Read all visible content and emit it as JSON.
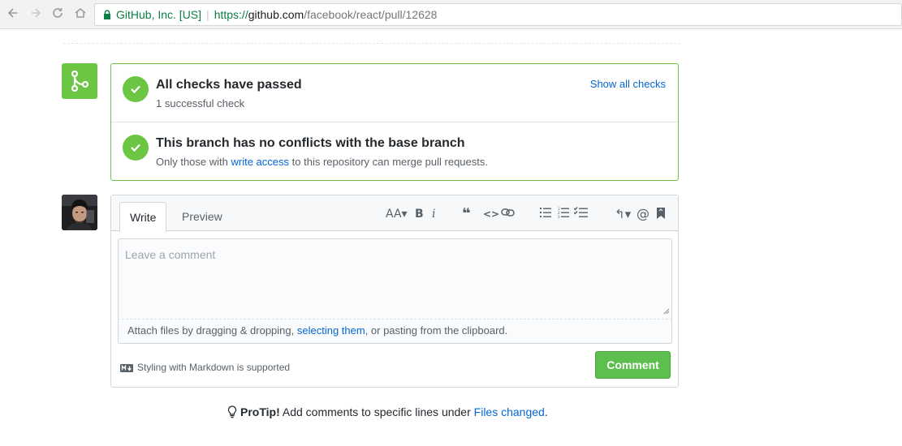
{
  "browser": {
    "back_icon": "arrow-left-icon",
    "forward_icon": "arrow-right-icon",
    "reload_icon": "reload-icon",
    "home_icon": "home-icon",
    "secure_label": "GitHub, Inc. [US]",
    "url_scheme": "https://",
    "url_host": "github.com",
    "url_path": "/facebook/react/pull/12628"
  },
  "merge_status": {
    "icon": "git-merge-icon",
    "checks_title": "All checks have passed",
    "checks_subtitle": "1 successful check",
    "show_all_checks": "Show all checks",
    "conflicts_title": "This branch has no conflicts with the base branch",
    "conflicts_sub_prefix": "Only those with ",
    "conflicts_sub_link": "write access",
    "conflicts_sub_suffix": " to this repository can merge pull requests."
  },
  "comment": {
    "tabs": [
      "Write",
      "Preview"
    ],
    "toolbar": {
      "heading": "AA▾",
      "bold": "B",
      "italic": "i",
      "quote": "❝",
      "code": "<>",
      "reply": "↰▾",
      "mention": "@"
    },
    "placeholder": "Leave a comment",
    "attach_prefix": "Attach files by dragging & dropping, ",
    "attach_link": "selecting them",
    "attach_suffix": ", or pasting from the clipboard.",
    "markdown_note": "Styling with Markdown is supported",
    "submit_label": "Comment"
  },
  "protip": {
    "bold": "ProTip!",
    "text": " Add comments to specific lines under ",
    "link": "Files changed",
    "end": "."
  },
  "colors": {
    "success": "#6cc644",
    "link": "#0366d6",
    "button": "#5cbf4e"
  }
}
